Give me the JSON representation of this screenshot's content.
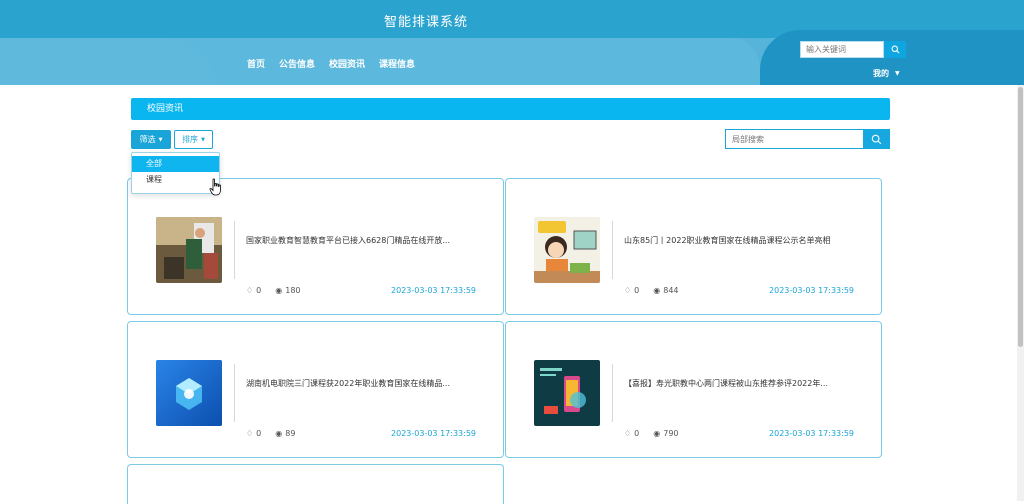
{
  "header": {
    "site_title": "智能排课系统",
    "nav": [
      {
        "label": "首页",
        "active": false
      },
      {
        "label": "公告信息",
        "active": false
      },
      {
        "label": "校园资讯",
        "active": true
      },
      {
        "label": "课程信息",
        "active": false
      }
    ],
    "search_placeholder": "输入关键词",
    "user_menu_label": "我的"
  },
  "section": {
    "title": "校园资讯"
  },
  "toolbar": {
    "filter_label": "筛选",
    "sort_label": "排序",
    "local_search_placeholder": "局部搜索"
  },
  "filter_dropdown": {
    "options": [
      {
        "label": "全部",
        "selected": true
      },
      {
        "label": "课程",
        "selected": false
      }
    ]
  },
  "news": [
    {
      "title": "国家职业教育智慧教育平台已接入6628门精品在线开放...",
      "likes": "0",
      "views": "180",
      "date": "2023-03-03 17:33:59",
      "thumb": "photo-classroom"
    },
    {
      "title": "山东85门丨2022职业教育国家在线精品课程公示名单亮相",
      "likes": "0",
      "views": "844",
      "date": "2023-03-03 17:33:59",
      "thumb": "cartoon-student"
    },
    {
      "title": "湖南机电职院三门课程获2022年职业教育国家在线精品...",
      "likes": "0",
      "views": "89",
      "date": "2023-03-03 17:33:59",
      "thumb": "blue-3d-icon"
    },
    {
      "title": "【喜报】寿光职教中心两门课程被山东推荐参评2022年...",
      "likes": "0",
      "views": "790",
      "date": "2023-03-03 17:33:59",
      "thumb": "dark-phone-graphic"
    }
  ],
  "colors": {
    "primary": "#0ab6ef",
    "header_bg": "#2ba3cf",
    "card_border": "#7bcbe6",
    "date_text": "#1aa5d8"
  }
}
